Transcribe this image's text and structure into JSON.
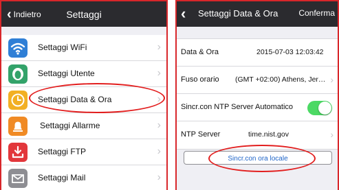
{
  "left": {
    "back_label": "Indietro",
    "title": "Settaggi",
    "items": [
      {
        "label": "Settaggi WiFi",
        "icon": "wifi-icon",
        "color": "#2f7fd6"
      },
      {
        "label": "Settaggi Utente",
        "icon": "user-icon",
        "color": "#33a36a"
      },
      {
        "label": "Settaggi Data & Ora",
        "icon": "clock-icon",
        "color": "#f2b024"
      },
      {
        "label": "Settaggi Allarme",
        "icon": "bell-icon",
        "color": "#f08a24"
      },
      {
        "label": "Settaggi FTP",
        "icon": "download-icon",
        "color": "#e2373b"
      },
      {
        "label": "Settaggi Mail",
        "icon": "mail-icon",
        "color": "#8e8e93"
      }
    ]
  },
  "right": {
    "title": "Settaggi Data & Ora",
    "confirm_label": "Conferma",
    "datetime": {
      "label": "Data & Ora",
      "value": "2015-07-03 12:03:42"
    },
    "timezone": {
      "label": "Fuso orario",
      "value": "(GMT +02:00) Athens, Jer…"
    },
    "ntp_auto": {
      "label": "Sincr.con NTP Server Automatico",
      "enabled": true
    },
    "ntp_server": {
      "label": "NTP Server",
      "value": "time.nist.gov"
    },
    "sync_local_button": "Sincr.con ora locale"
  },
  "colors": {
    "accent_red": "#e21e1e",
    "toggle_green": "#4cd964",
    "nav_bar": "#2b2b2f",
    "link_blue": "#1e64c8"
  }
}
